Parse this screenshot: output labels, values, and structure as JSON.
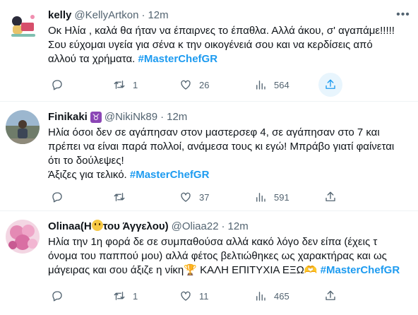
{
  "colors": {
    "accent": "#1d9bf0",
    "muted": "#536471"
  },
  "tweets": [
    {
      "name": "kelly",
      "handle": "@KellyArtkon",
      "sep": "·",
      "time": "12m",
      "lines": [
        "Οκ Ηλία , καλά θα ήταν να έπαιρνες το έπαθλα. Αλλά άκου, σ' αγαπάμε!!!!!",
        "Σου εύχομαι υγεία για σένα κ την οικογένειά σου και να κερδίσεις από",
        "αλλού τα χρήματα. "
      ],
      "hashtag": "#MasterChefGR",
      "actions": {
        "reply": "",
        "retweet": "1",
        "like": "26",
        "views": "564"
      }
    },
    {
      "name": "Finikaki",
      "emoji": "♉",
      "handle": "@NikiNk89",
      "sep": "·",
      "time": "12m",
      "lines": [
        "Ηλία όσοι δεν σε αγάπησαν στον μαστερσεφ 4, σε αγάπησαν στο 7 και",
        "πρέπει να είναι παρά πολλοί, ανάμεσα τους κι εγώ! Μπράβο γιατί φαίνεται",
        "ότι το δούλεψες!",
        "Άξιζες για τελικό. "
      ],
      "hashtag": "#MasterChefGR",
      "actions": {
        "reply": "",
        "retweet": "",
        "like": "37",
        "views": "591"
      }
    },
    {
      "name_a": "Olinaa(Η",
      "name_b": "του Άγγελου)",
      "handle": "@Oliaa22",
      "sep": "·",
      "time": "12m",
      "lines": [
        "Ηλία την 1η φορά δε σε συμπαθούσα αλλά κακό λόγο δεν είπα (έχεις τ",
        "όνομα του παππού μου) αλλά φέτος βελτιώθηκες ως χαρακτήρας και ως",
        "μάγειρας και σου άξιζε η νίκη🏆 ΚΑΛΗ ΕΠΙΤΥΧΙΑ ΕΞΩ🫶 "
      ],
      "hashtag": "#MasterChefGR",
      "actions": {
        "reply": "",
        "retweet": "1",
        "like": "11",
        "views": "465"
      }
    }
  ]
}
